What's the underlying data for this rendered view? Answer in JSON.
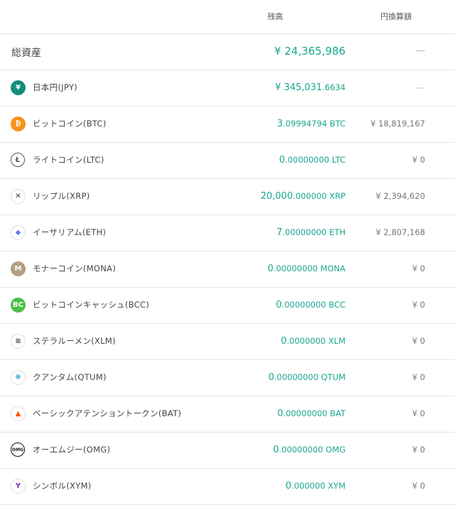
{
  "header": {
    "balance_label": "残高",
    "jpy_label": "円換算額"
  },
  "total": {
    "label": "総資産",
    "amount": "¥ 24,365,986",
    "jpy": "---"
  },
  "assets": [
    {
      "icon": "yen-icon",
      "glyph": "¥",
      "name": "日本円(JPY)",
      "bal_int": "¥ 345,031",
      "bal_dec": ".6634",
      "bal_unit": "",
      "jpy": "---"
    },
    {
      "icon": "bitcoin-icon",
      "glyph": "₿",
      "name": "ビットコイン(BTC)",
      "bal_int": "3",
      "bal_dec": ".09994794",
      "bal_unit": " BTC",
      "jpy": "¥ 18,819,167"
    },
    {
      "icon": "litecoin-icon",
      "glyph": "Ł",
      "name": "ライトコイン(LTC)",
      "bal_int": "0",
      "bal_dec": ".00000000",
      "bal_unit": " LTC",
      "jpy": "¥ 0"
    },
    {
      "icon": "ripple-icon",
      "glyph": "✕",
      "name": "リップル(XRP)",
      "bal_int": "20,000",
      "bal_dec": ".000000",
      "bal_unit": " XRP",
      "jpy": "¥ 2,394,620"
    },
    {
      "icon": "ethereum-icon",
      "glyph": "◆",
      "name": "イーサリアム(ETH)",
      "bal_int": "7",
      "bal_dec": ".00000000",
      "bal_unit": " ETH",
      "jpy": "¥ 2,807,168"
    },
    {
      "icon": "monacoin-icon",
      "glyph": "M",
      "name": "モナーコイン(MONA)",
      "bal_int": "0",
      "bal_dec": ".00000000",
      "bal_unit": " MONA",
      "jpy": "¥ 0"
    },
    {
      "icon": "bitcoin-cash-icon",
      "glyph": "BC",
      "name": "ビットコインキャッシュ(BCC)",
      "bal_int": "0",
      "bal_dec": ".00000000",
      "bal_unit": " BCC",
      "jpy": "¥ 0"
    },
    {
      "icon": "stellar-icon",
      "glyph": "≋",
      "name": "ステラルーメン(XLM)",
      "bal_int": "0",
      "bal_dec": ".0000000",
      "bal_unit": " XLM",
      "jpy": "¥ 0"
    },
    {
      "icon": "qtum-icon",
      "glyph": "❋",
      "name": "クアンタム(QTUM)",
      "bal_int": "0",
      "bal_dec": ".00000000",
      "bal_unit": " QTUM",
      "jpy": "¥ 0"
    },
    {
      "icon": "bat-icon",
      "glyph": "▲",
      "name": "ベーシックアテンショントークン(BAT)",
      "bal_int": "0",
      "bal_dec": ".00000000",
      "bal_unit": " BAT",
      "jpy": "¥ 0"
    },
    {
      "icon": "omg-icon",
      "glyph": "OMG",
      "name": "オーエムジー(OMG)",
      "bal_int": "0",
      "bal_dec": ".00000000",
      "bal_unit": " OMG",
      "jpy": "¥ 0"
    },
    {
      "icon": "symbol-icon",
      "glyph": "Y",
      "name": "シンボル(XYM)",
      "bal_int": "0",
      "bal_dec": ".000000",
      "bal_unit": " XYM",
      "jpy": "¥ 0"
    }
  ],
  "colors": {
    "accent": "#1aa68f",
    "jpy": "#148e7c",
    "btc": "#f7931a",
    "mona": "#b49f81",
    "bcc": "#4cc046",
    "eth": "#627eea",
    "xlm": "#3c3c3c",
    "qtum": "#2e9ad0",
    "bat": "#ff5000",
    "xym": "#7b2aa0",
    "ltc": "#555555"
  }
}
